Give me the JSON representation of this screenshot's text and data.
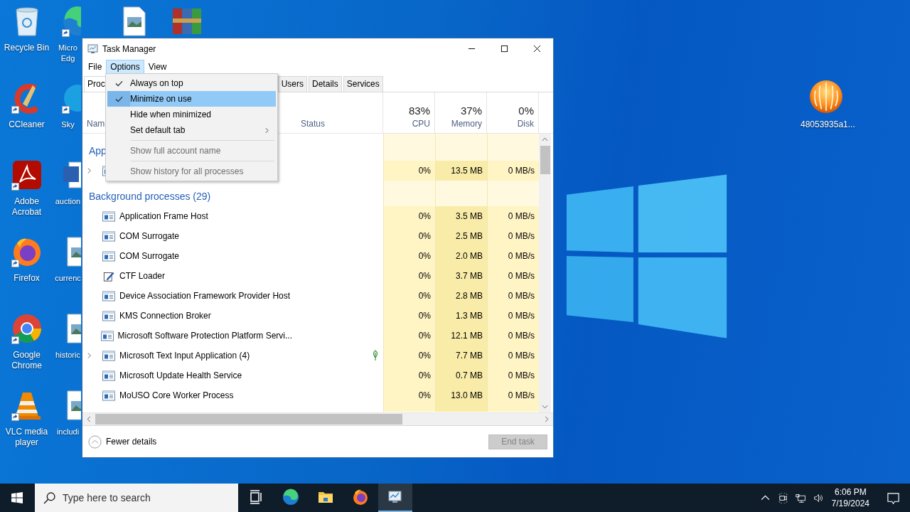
{
  "desktop_columns": [
    [
      {
        "kind": "recycle-bin",
        "label": "Recycle Bin",
        "shortcut": false
      },
      {
        "kind": "ccleaner",
        "label": "CCleaner",
        "shortcut": true
      },
      {
        "kind": "acrobat",
        "label": "Adobe Acrobat",
        "shortcut": true
      },
      {
        "kind": "firefox",
        "label": "Firefox",
        "shortcut": true
      },
      {
        "kind": "chrome",
        "label": "Google Chrome",
        "shortcut": true
      },
      {
        "kind": "vlc",
        "label": "VLC media player",
        "shortcut": true
      }
    ],
    [
      {
        "kind": "edge",
        "label": "Micro Edg",
        "shortcut": true
      },
      {
        "kind": "skype",
        "label": "Sky",
        "shortcut": true
      },
      {
        "kind": "word",
        "label": "auction",
        "shortcut": false
      },
      {
        "kind": "image-file",
        "label": "currenc",
        "shortcut": false
      },
      {
        "kind": "image-file",
        "label": "historic",
        "shortcut": false
      },
      {
        "kind": "image-file",
        "label": "includi",
        "shortcut": false
      }
    ],
    [
      {
        "kind": "image-file",
        "shortcut": false
      }
    ],
    [
      {
        "kind": "winrar",
        "shortcut": false
      }
    ]
  ],
  "desktop_right_icon": {
    "kind": "orb",
    "label": "48053935a1..."
  },
  "window": {
    "title": "Task Manager"
  },
  "menu_bar": [
    {
      "label": "File",
      "selected": false
    },
    {
      "label": "Options",
      "selected": true
    },
    {
      "label": "View",
      "selected": false
    }
  ],
  "tabs": [
    {
      "label": "Proc",
      "selected": true
    },
    {
      "label": "Users",
      "selected": false
    },
    {
      "label": "Details",
      "selected": false
    },
    {
      "label": "Services",
      "selected": false
    }
  ],
  "options_menu": {
    "items": [
      {
        "kind": "item",
        "label": "Always on top",
        "checked": true,
        "selected": false,
        "disabled": false,
        "submenu": false
      },
      {
        "kind": "item",
        "label": "Minimize on use",
        "checked": true,
        "selected": true,
        "disabled": false,
        "submenu": false
      },
      {
        "kind": "item",
        "label": "Hide when minimized",
        "checked": false,
        "selected": false,
        "disabled": false,
        "submenu": false
      },
      {
        "kind": "item",
        "label": "Set default tab",
        "checked": false,
        "selected": false,
        "disabled": false,
        "submenu": true
      },
      {
        "kind": "separator"
      },
      {
        "kind": "item",
        "label": "Show full account name",
        "checked": false,
        "selected": false,
        "disabled": true,
        "submenu": false
      },
      {
        "kind": "separator"
      },
      {
        "kind": "item",
        "label": "Show history for all processes",
        "checked": false,
        "selected": false,
        "disabled": true,
        "submenu": false
      }
    ]
  },
  "table": {
    "columns": [
      {
        "label": "Nam"
      },
      {
        "label": "Status"
      },
      {
        "label": "CPU",
        "total": "83%"
      },
      {
        "label": "Memory",
        "total": "37%"
      },
      {
        "label": "Disk",
        "total": "0%"
      }
    ],
    "rows": [
      {
        "kind": "group",
        "label": "App"
      },
      {
        "kind": "process",
        "expandable": true,
        "suspended": false,
        "cpu": "0%",
        "memory": "13.5 MB",
        "disk": "0 MB/s"
      },
      {
        "kind": "group",
        "label": "Background processes (29)"
      },
      {
        "kind": "process",
        "name": "Application Frame Host",
        "expandable": false,
        "suspended": false,
        "cpu": "0%",
        "memory": "3.5 MB",
        "disk": "0 MB/s"
      },
      {
        "kind": "process",
        "name": "COM Surrogate",
        "expandable": false,
        "suspended": false,
        "cpu": "0%",
        "memory": "2.5 MB",
        "disk": "0 MB/s"
      },
      {
        "kind": "process",
        "name": "COM Surrogate",
        "expandable": false,
        "suspended": false,
        "cpu": "0%",
        "memory": "2.0 MB",
        "disk": "0 MB/s"
      },
      {
        "kind": "pen-process",
        "name": "CTF Loader",
        "expandable": false,
        "suspended": false,
        "cpu": "0%",
        "memory": "3.7 MB",
        "disk": "0 MB/s"
      },
      {
        "kind": "process",
        "name": "Device Association Framework Provider Host",
        "expandable": false,
        "suspended": false,
        "cpu": "0%",
        "memory": "2.8 MB",
        "disk": "0 MB/s"
      },
      {
        "kind": "process",
        "name": "KMS Connection Broker",
        "expandable": false,
        "suspended": false,
        "cpu": "0%",
        "memory": "1.3 MB",
        "disk": "0 MB/s"
      },
      {
        "kind": "process",
        "name": "Microsoft Software Protection Platform Servi...",
        "expandable": false,
        "suspended": false,
        "cpu": "0%",
        "memory": "12.1 MB",
        "disk": "0 MB/s"
      },
      {
        "kind": "process",
        "name": "Microsoft Text Input Application (4)",
        "expandable": true,
        "suspended": true,
        "cpu": "0%",
        "memory": "7.7 MB",
        "disk": "0 MB/s"
      },
      {
        "kind": "process",
        "name": "Microsoft Update Health Service",
        "expandable": false,
        "suspended": false,
        "cpu": "0%",
        "memory": "0.7 MB",
        "disk": "0 MB/s"
      },
      {
        "kind": "process",
        "name": "MoUSO Core Worker Process",
        "expandable": false,
        "suspended": false,
        "cpu": "0%",
        "memory": "13.0 MB",
        "disk": "0 MB/s"
      }
    ]
  },
  "footer": {
    "details_link": "Fewer details",
    "end_task": {
      "label": "End task",
      "disabled": true
    }
  },
  "taskbar": {
    "search": {
      "placeholder": "Type here to search"
    },
    "apps": [
      {
        "kind": "task-view",
        "active": false
      },
      {
        "kind": "edge",
        "active": false
      },
      {
        "kind": "folder",
        "active": false
      },
      {
        "kind": "firefox",
        "active": false
      },
      {
        "kind": "task-manager",
        "active": true
      }
    ],
    "clock": {
      "time": "6:06 PM",
      "date": "7/19/2024"
    }
  }
}
